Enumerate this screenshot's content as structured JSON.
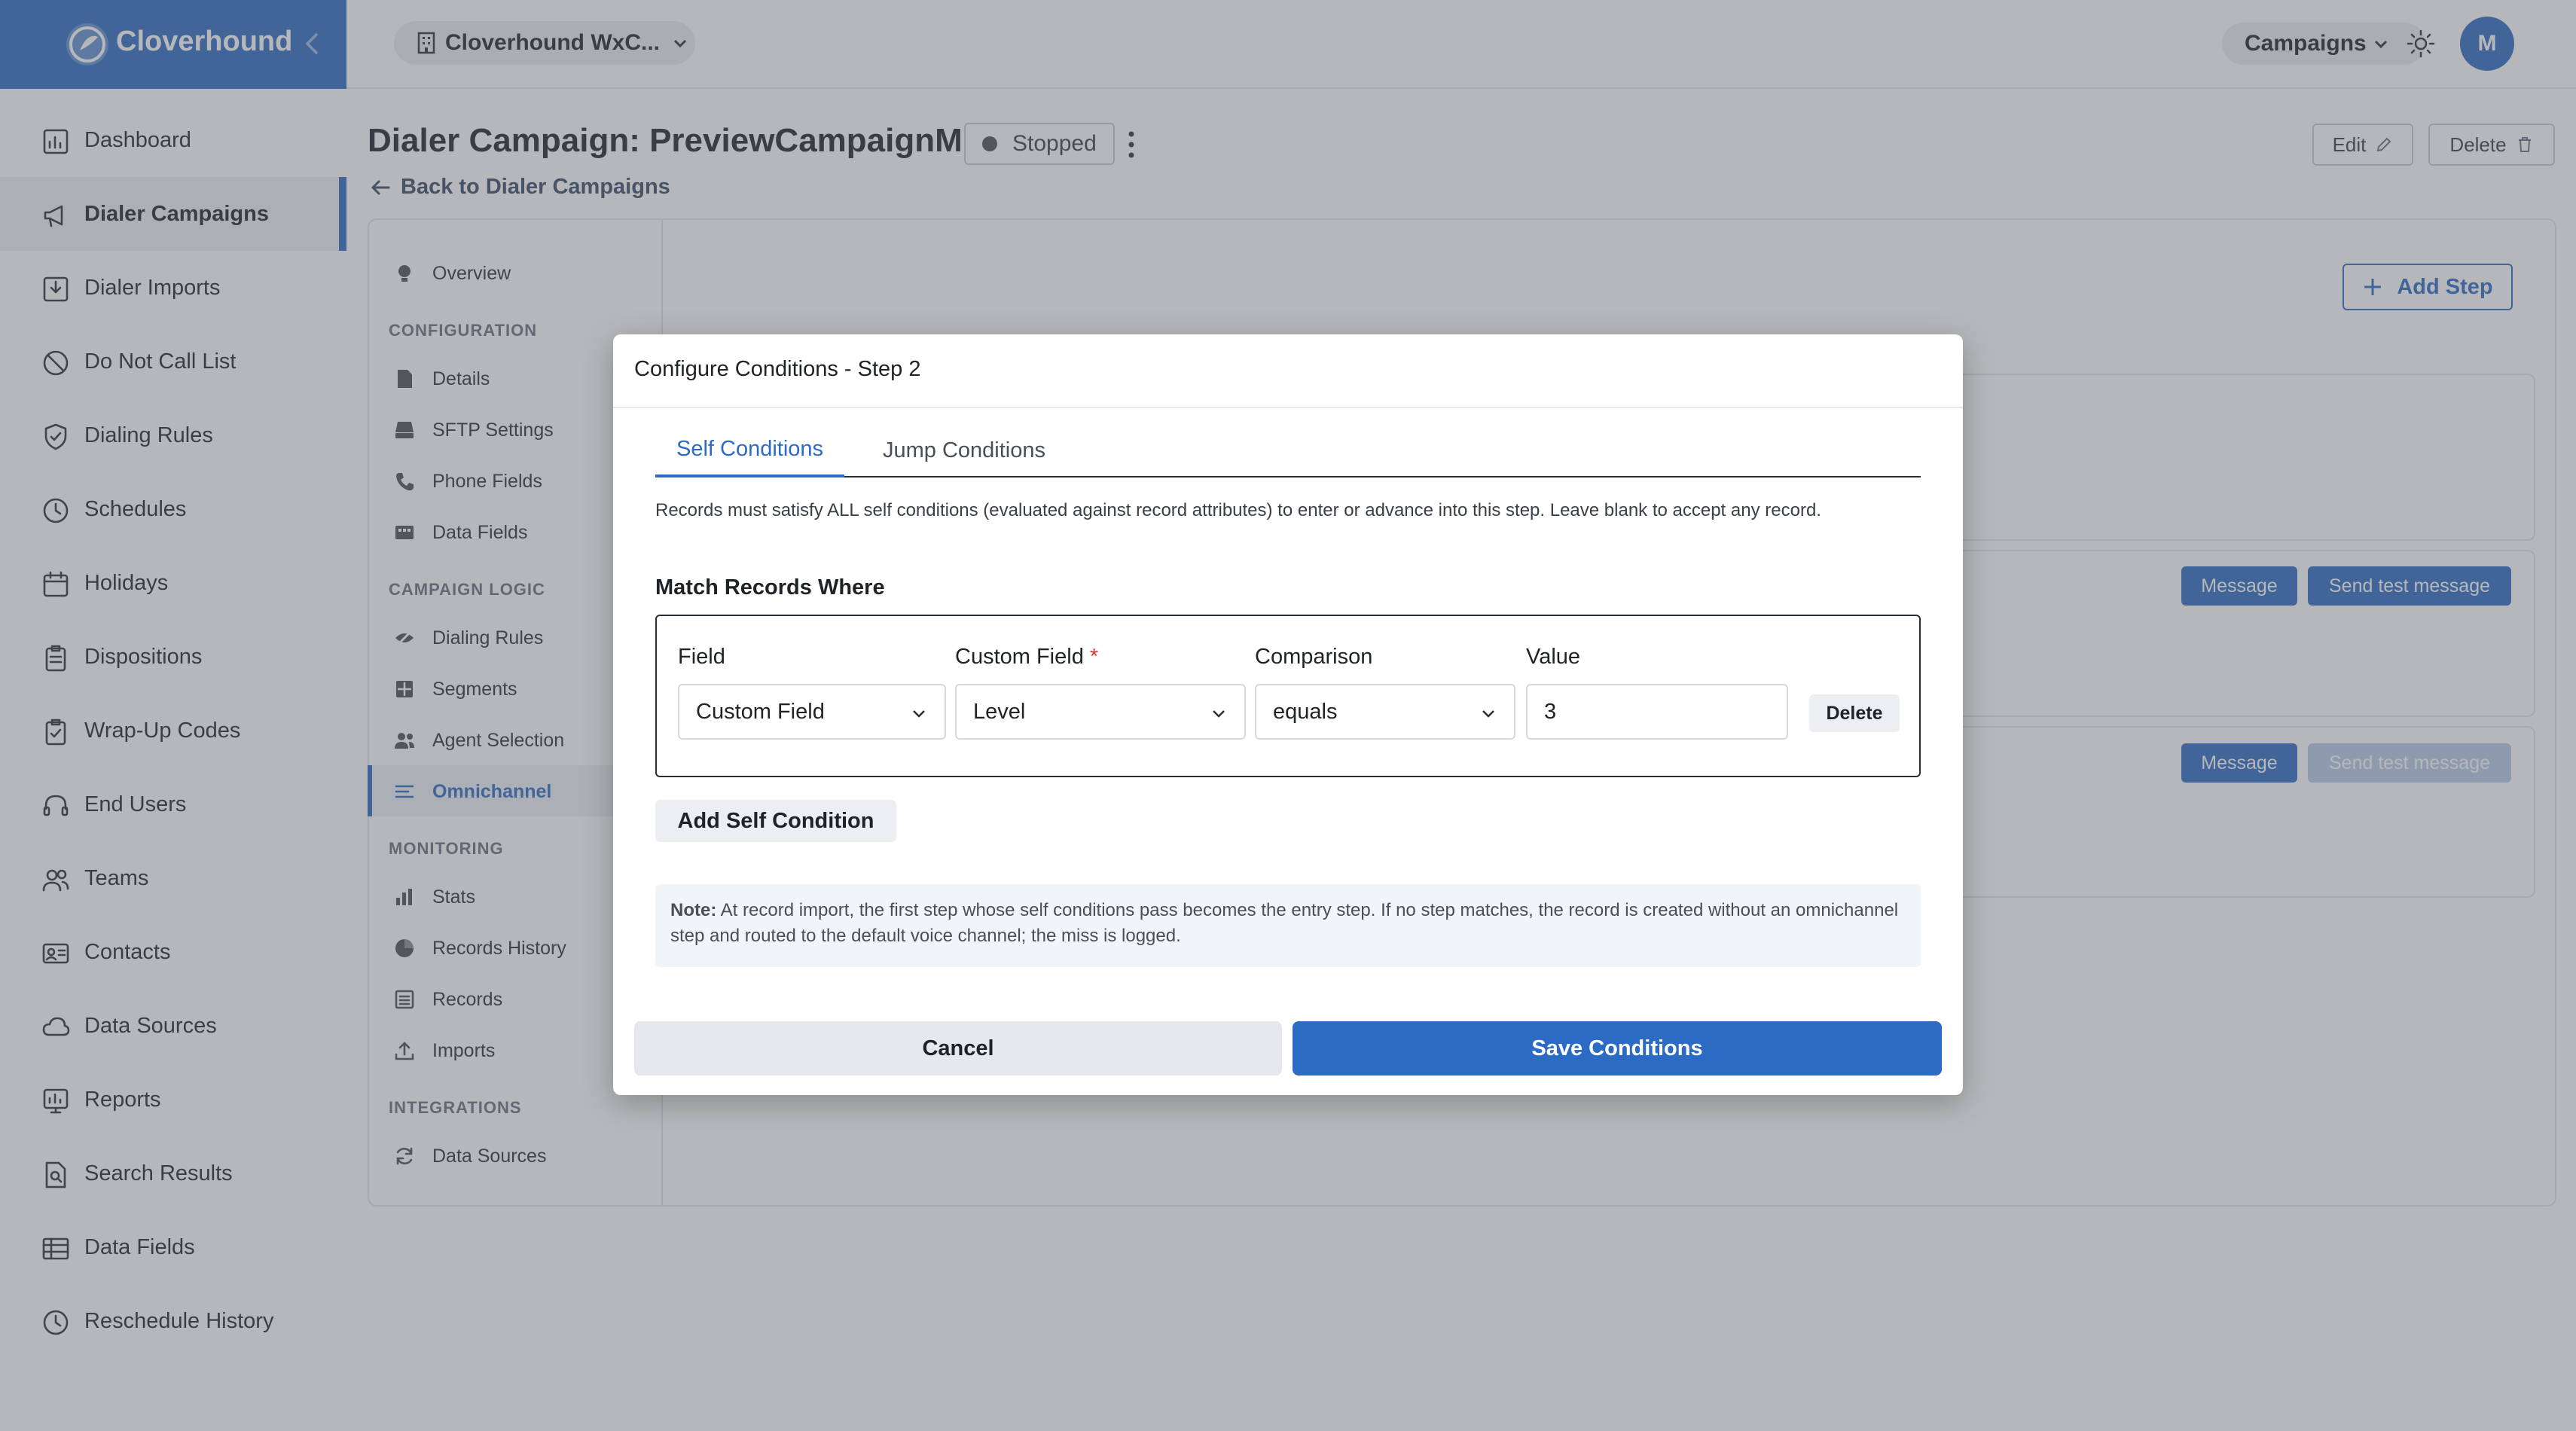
{
  "app": {
    "name": "Cloverhound"
  },
  "colors": {
    "accent": "#2c6bc4",
    "overlay": "rgba(90,95,102,0.45)"
  },
  "topbar": {
    "org_selector": "Cloverhound WxC...",
    "section_selector": "Campaigns",
    "avatar_initial": "M"
  },
  "sidebar": {
    "items": [
      {
        "label": "Dashboard",
        "icon": "chart-icon"
      },
      {
        "label": "Dialer Campaigns",
        "icon": "megaphone-icon",
        "active": true
      },
      {
        "label": "Dialer Imports",
        "icon": "import-icon"
      },
      {
        "label": "Do Not Call List",
        "icon": "block-icon"
      },
      {
        "label": "Dialing Rules",
        "icon": "shield-icon"
      },
      {
        "label": "Schedules",
        "icon": "clock-icon"
      },
      {
        "label": "Holidays",
        "icon": "calendar-icon"
      },
      {
        "label": "Dispositions",
        "icon": "clipboard-icon"
      },
      {
        "label": "Wrap-Up Codes",
        "icon": "clipboard-check-icon"
      },
      {
        "label": "End Users",
        "icon": "headset-icon"
      },
      {
        "label": "Teams",
        "icon": "users-icon"
      },
      {
        "label": "Contacts",
        "icon": "contact-card-icon"
      },
      {
        "label": "Data Sources",
        "icon": "cloud-icon"
      },
      {
        "label": "Reports",
        "icon": "report-icon"
      },
      {
        "label": "Search Results",
        "icon": "search-doc-icon"
      },
      {
        "label": "Data Fields",
        "icon": "table-icon"
      },
      {
        "label": "Reschedule History",
        "icon": "history-icon"
      }
    ]
  },
  "page": {
    "title": "Dialer Campaign: PreviewCampaignM",
    "status": "Stopped",
    "back_link": "Back to Dialer Campaigns",
    "edit_label": "Edit",
    "delete_label": "Delete"
  },
  "subnav": {
    "overview": "Overview",
    "sections": [
      {
        "heading": "CONFIGURATION",
        "items": [
          "Details",
          "SFTP Settings",
          "Phone Fields",
          "Data Fields"
        ]
      },
      {
        "heading": "CAMPAIGN LOGIC",
        "items": [
          "Dialing Rules",
          "Segments",
          "Agent Selection",
          "Omnichannel"
        ]
      },
      {
        "heading": "MONITORING",
        "items": [
          "Stats",
          "Records History",
          "Records",
          "Imports"
        ]
      },
      {
        "heading": "INTEGRATIONS",
        "items": [
          "Data Sources"
        ]
      }
    ],
    "active": "Omnichannel"
  },
  "content": {
    "add_step": "Add Step",
    "message_label": "Message",
    "send_test_label": "Send test message"
  },
  "modal": {
    "title": "Configure Conditions - Step 2",
    "tabs": [
      "Self Conditions",
      "Jump Conditions"
    ],
    "active_tab": "Self Conditions",
    "description": "Records must satisfy ALL self conditions (evaluated against record attributes) to enter or advance into this step. Leave blank to accept any record.",
    "match_title": "Match Records Where",
    "condition": {
      "field_label": "Field",
      "field_value": "Custom Field",
      "custom_field_label": "Custom Field",
      "required_mark": "*",
      "custom_field_value": "Level",
      "comparison_label": "Comparison",
      "comparison_value": "equals",
      "value_label": "Value",
      "value_value": "3",
      "delete_label": "Delete"
    },
    "add_condition": "Add Self Condition",
    "note_label": "Note:",
    "note_text": "At record import, the first step whose self conditions pass becomes the entry step. If no step matches, the record is created without an omnichannel step and routed to the default voice channel; the miss is logged.",
    "cancel": "Cancel",
    "save": "Save Conditions"
  }
}
